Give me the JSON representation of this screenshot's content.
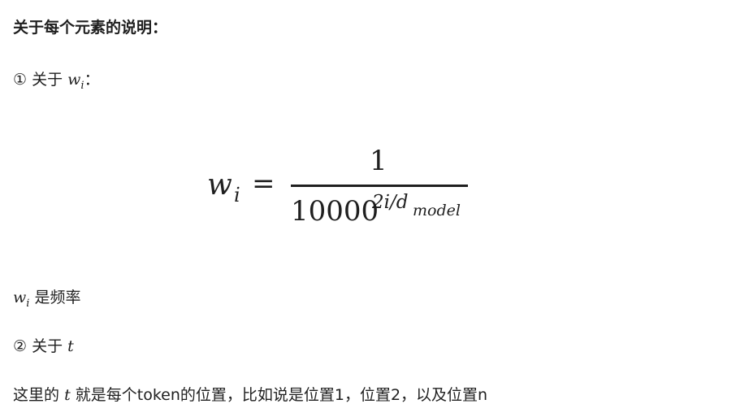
{
  "heading": "关于每个元素的说明：",
  "item1": {
    "marker": "①",
    "text": "关于",
    "var": "w",
    "var_sub": "i",
    "suffix": "："
  },
  "formula": {
    "lhs": "w",
    "lhs_sub": "i",
    "equals": "=",
    "numerator": "1",
    "denominator_base": "10000",
    "exponent": "2i/d",
    "exponent_sub": "model"
  },
  "note1": {
    "var": "w",
    "var_sub": "i",
    "text": "是频率"
  },
  "item2": {
    "marker": "②",
    "text": "关于",
    "var": "t"
  },
  "note2": {
    "prefix": "这里的",
    "var": "t",
    "text": "就是每个token的位置，比如说是位置1，位置2，以及位置n"
  }
}
